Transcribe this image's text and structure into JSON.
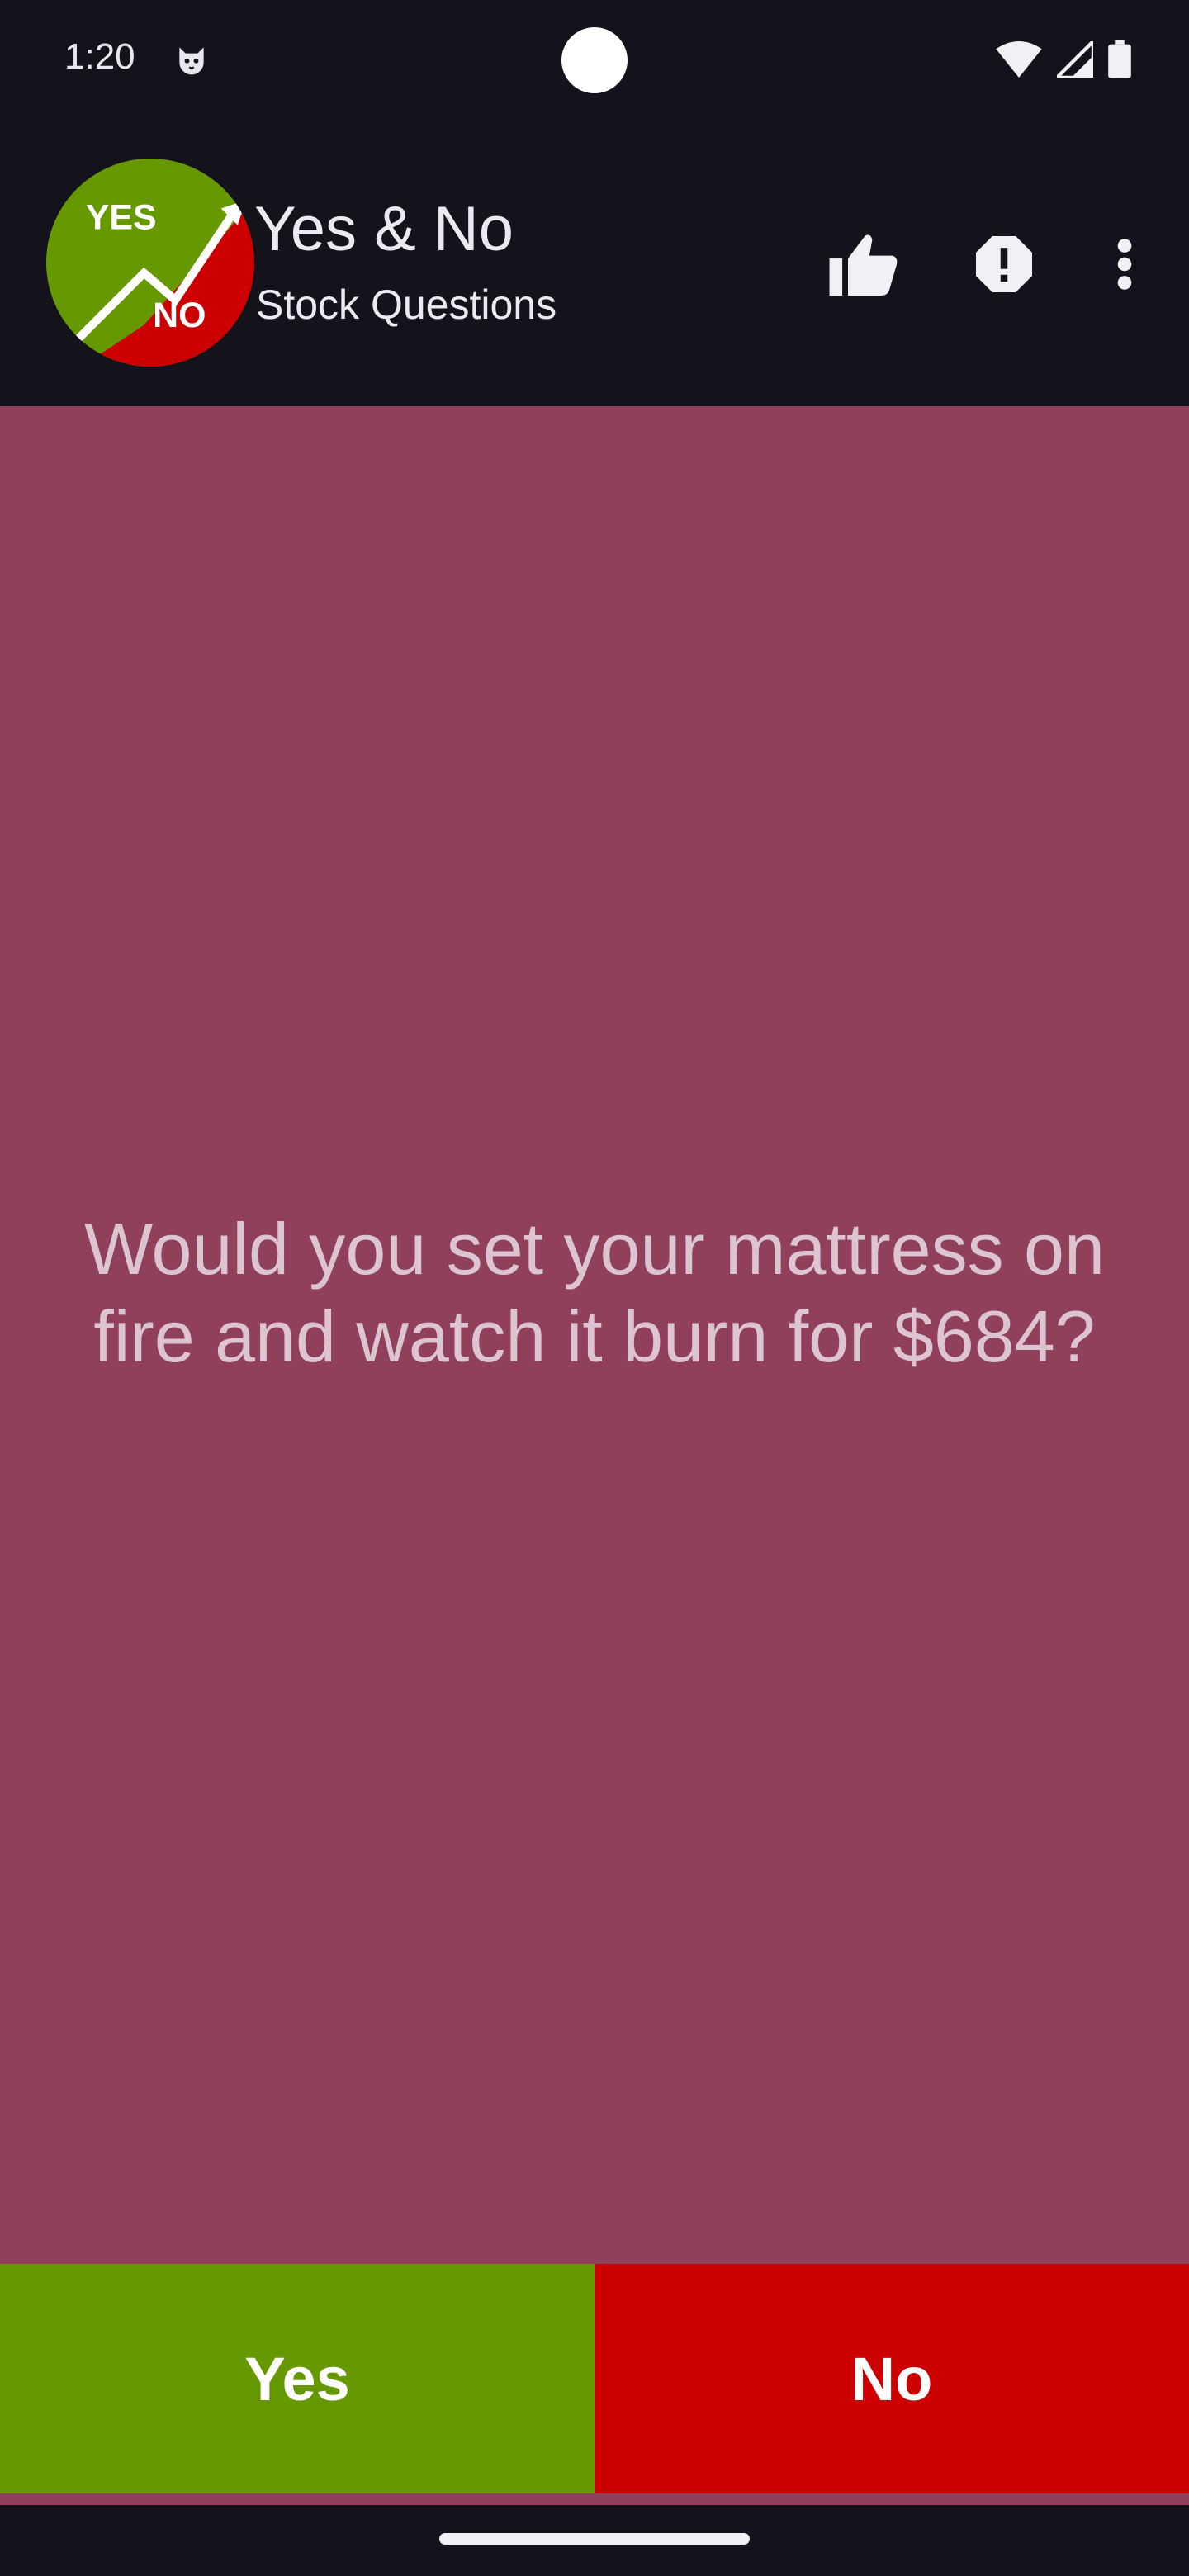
{
  "status_bar": {
    "time": "1:20",
    "icons": [
      "cat-face-icon",
      "wifi-icon",
      "cell-signal-icon",
      "battery-icon"
    ]
  },
  "app_bar": {
    "logo": {
      "top_text": "YES",
      "bottom_text": "NO",
      "colors": {
        "yes": "#669900",
        "no": "#cc0000"
      }
    },
    "title": "Yes & No",
    "subtitle": "Stock Questions",
    "actions": [
      "thumbs-up-icon",
      "report-icon",
      "more-vert-icon"
    ]
  },
  "question": {
    "text": "Would you set your mattress on fire and watch it burn for $684?",
    "background": "#91405c"
  },
  "answers": {
    "yes_label": "Yes",
    "no_label": "No",
    "yes_color": "#669900",
    "no_color": "#cc0000"
  }
}
